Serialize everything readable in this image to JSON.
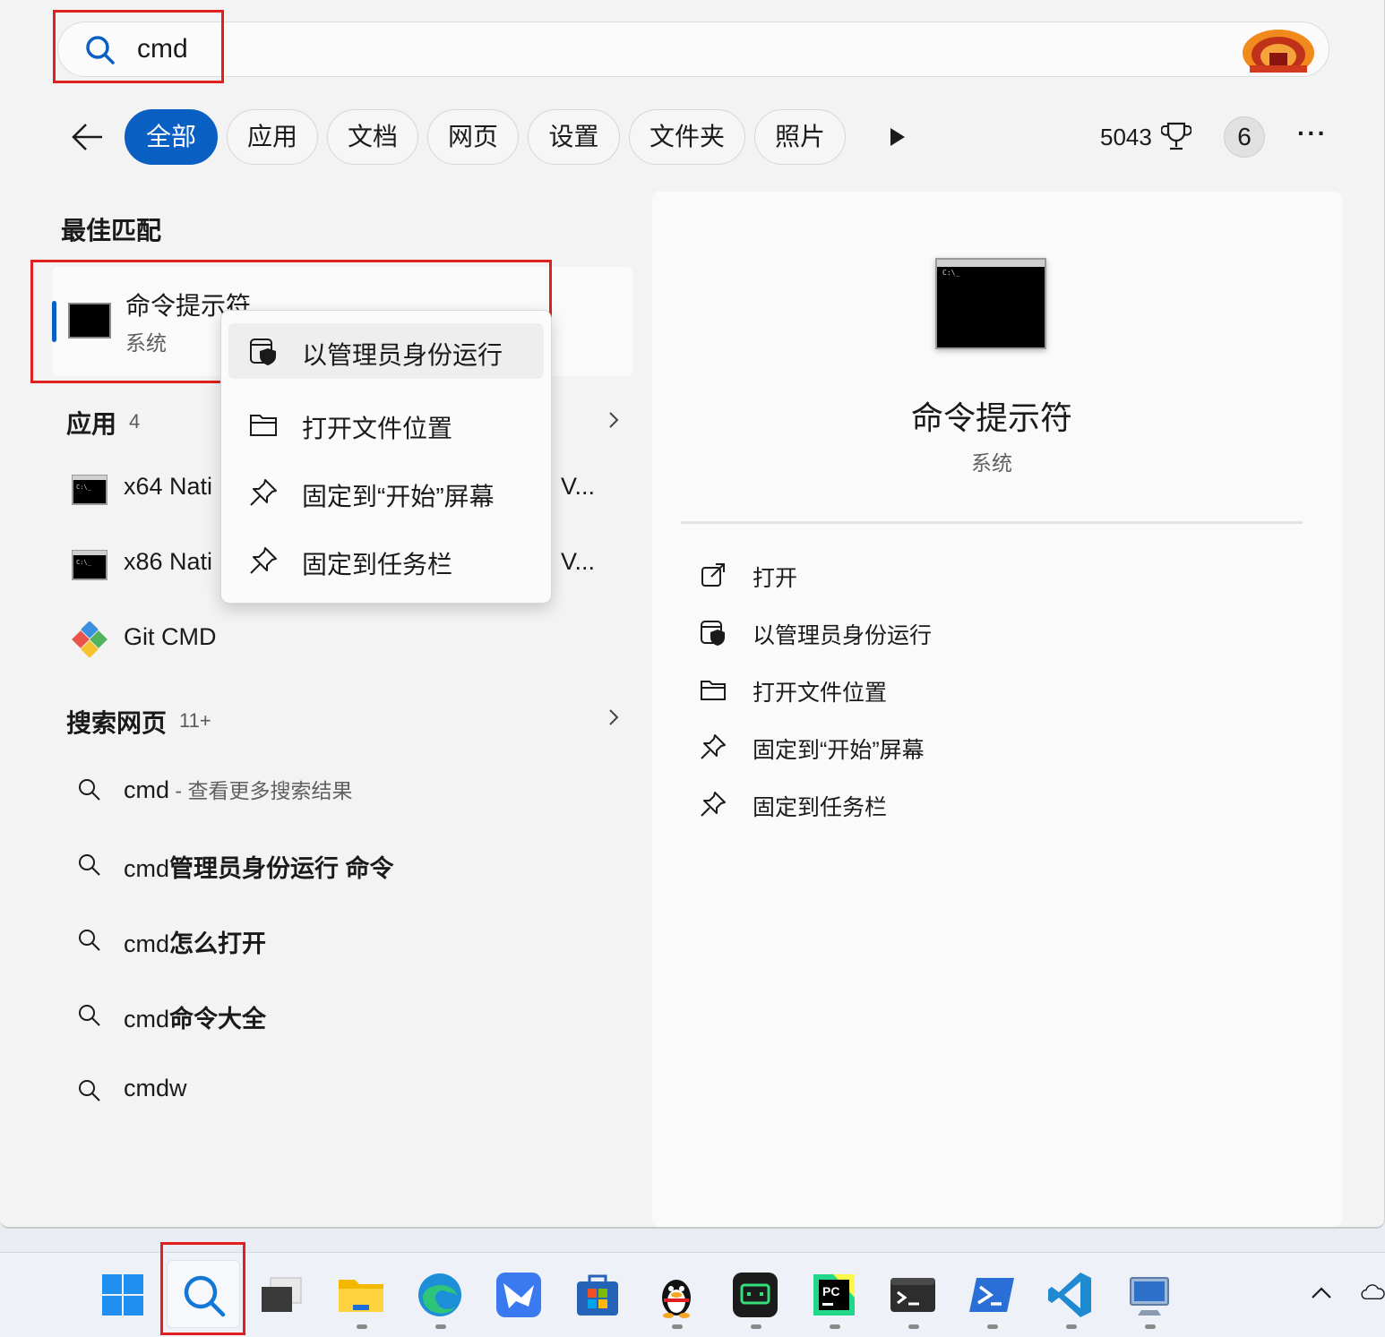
{
  "search": {
    "query": "cmd"
  },
  "filters": {
    "tabs": [
      "全部",
      "应用",
      "文档",
      "网页",
      "设置",
      "文件夹",
      "照片"
    ],
    "score": "5043",
    "notification_count": "6",
    "more": "···"
  },
  "best_match": {
    "section_title": "最佳匹配",
    "name": "命令提示符",
    "subtitle": "系统"
  },
  "apps": {
    "section_title": "应用",
    "count": "4",
    "items": [
      {
        "label": "x64 Nati",
        "tail": "V..."
      },
      {
        "label": "x86 Nati",
        "tail": "V..."
      },
      {
        "label": "Git CMD"
      }
    ]
  },
  "web": {
    "section_title": "搜索网页",
    "count": "11+",
    "items": [
      {
        "prefix": "cmd",
        "rest": " - 查看更多搜索结果",
        "bold": false
      },
      {
        "prefix": "cmd",
        "rest": "管理员身份运行 命令",
        "bold": true
      },
      {
        "prefix": "cmd",
        "rest": "怎么打开",
        "bold": true
      },
      {
        "prefix": "cmd",
        "rest": "命令大全",
        "bold": true
      },
      {
        "prefix": "cmdw",
        "rest": "",
        "bold": true
      }
    ]
  },
  "context_menu": {
    "items": [
      "以管理员身份运行",
      "打开文件位置",
      "固定到“开始”屏幕",
      "固定到任务栏"
    ]
  },
  "details": {
    "title": "命令提示符",
    "subtitle": "系统",
    "prompt_text": "C:\\_",
    "actions": [
      "打开",
      "以管理员身份运行",
      "打开文件位置",
      "固定到“开始”屏幕",
      "固定到任务栏"
    ]
  },
  "colors": {
    "accent": "#0a5fc2",
    "highlight_box": "#e0201f"
  },
  "taskbar": {
    "apps": [
      "start-icon",
      "search-icon",
      "task-view-icon",
      "file-explorer-icon",
      "edge-icon",
      "feishu-icon",
      "store-icon",
      "qq-icon",
      "app-icon",
      "pycharm-icon",
      "terminal-icon",
      "powershell-icon",
      "vscode-icon",
      "remote-desktop-icon"
    ]
  }
}
